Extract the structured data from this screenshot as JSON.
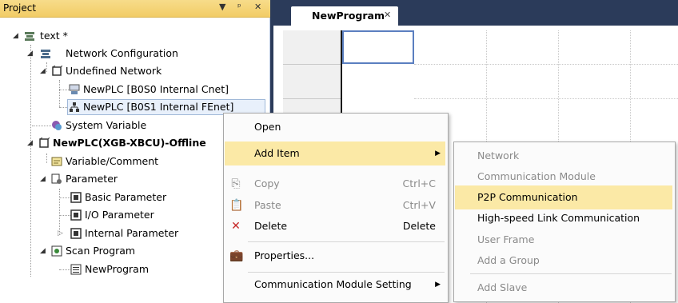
{
  "panel": {
    "title": "Project",
    "buttons": [
      "▼",
      "ᵖ",
      "✕"
    ]
  },
  "tree": {
    "root": "text *",
    "network_config": "Network Configuration",
    "undefined_network": "Undefined Network",
    "plc1": "NewPLC [B0S0 Internal Cnet]",
    "plc2": "NewPLC [B0S1 Internal FEnet]",
    "system_variable": "System Variable",
    "newplc": "NewPLC(XGB-XBCU)-Offline",
    "variable_comment": "Variable/Comment",
    "parameter": "Parameter",
    "basic_parameter": "Basic Parameter",
    "io_parameter": "I/O Parameter",
    "internal_parameter": "Internal Parameter",
    "scan_program": "Scan Program",
    "new_program": "NewProgram"
  },
  "tab": {
    "label": "NewProgram",
    "close": "✕"
  },
  "context_menu": {
    "open": "Open",
    "add_item": "Add Item",
    "copy": "Copy",
    "copy_shortcut": "Ctrl+C",
    "paste": "Paste",
    "paste_shortcut": "Ctrl+V",
    "delete": "Delete",
    "delete_shortcut": "Delete",
    "properties": "Properties...",
    "comm_setting": "Communication Module Setting"
  },
  "submenu": {
    "network": "Network",
    "comm_module": "Communication Module",
    "p2p": "P2P Communication",
    "hs_link": "High-speed Link Communication",
    "user_frame": "User Frame",
    "add_group": "Add a Group",
    "add_slave": "Add Slave"
  },
  "colors": {
    "header": "#f2cc66",
    "doc_background": "#2b3b5a",
    "menu_highlight": "#fbe9a6"
  }
}
